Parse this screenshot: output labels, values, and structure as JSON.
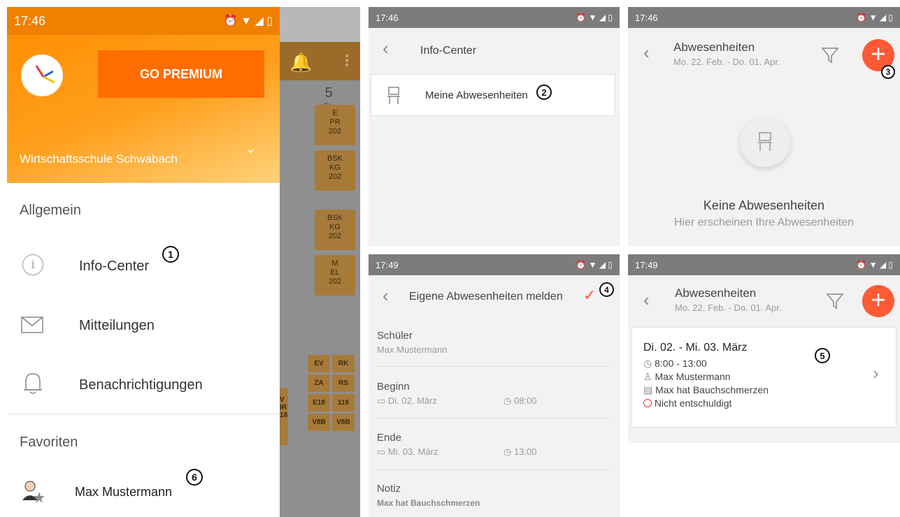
{
  "drawer": {
    "time": "17:46",
    "go_premium": "GO PREMIUM",
    "school": "Wirtschaftsschule Schwabach",
    "section_general": "Allgemein",
    "items": [
      {
        "label": "Info-Center",
        "icon": "info-icon"
      },
      {
        "label": "Mitteilungen",
        "icon": "mail-icon"
      },
      {
        "label": "Benachrichtigungen",
        "icon": "bell-icon"
      }
    ],
    "section_favorites": "Favoriten",
    "favorite_user": "Max Mustermann",
    "timetable_day_num": "5",
    "timetable_day_name": "Fr.",
    "timetable_cells": [
      {
        "text": "E\nPR\n202"
      },
      {
        "text": "BSK\nKG\n202"
      },
      {
        "text": "BSK\nKG\n202"
      },
      {
        "text": "M\nEL\n202"
      }
    ],
    "timetable_small": [
      [
        "EV",
        "RK"
      ],
      [
        "ZA",
        "RS"
      ],
      [
        "E18",
        "116"
      ],
      [
        "V8B",
        "V8B"
      ]
    ],
    "timetable_partial": [
      "V",
      "IR",
      "18"
    ],
    "badge1": "1",
    "badge6": "6"
  },
  "info_center": {
    "time": "17:46",
    "title": "Info-Center",
    "item": "Meine Abwesenheiten",
    "badge": "2"
  },
  "absences_empty": {
    "time": "17:46",
    "title": "Abwesenheiten",
    "range": "Mo. 22. Feb. - Do. 01. Apr.",
    "empty_title": "Keine Abwesenheiten",
    "empty_sub": "Hier erscheinen Ihre Abwesenheiten",
    "badge": "3"
  },
  "report_form": {
    "time": "17:49",
    "title": "Eigene Abwesenheiten melden",
    "badge": "4",
    "student_label": "Schüler",
    "student_value": "Max Mustermann",
    "begin_label": "Beginn",
    "begin_date": "Di. 02. März",
    "begin_time": "08:00",
    "end_label": "Ende",
    "end_date": "Mi. 03. März",
    "end_time": "13:00",
    "note_label": "Notiz",
    "note_value": "Max hat Bauchschmerzen"
  },
  "absences_list": {
    "time": "17:49",
    "title": "Abwesenheiten",
    "range": "Mo. 22. Feb. - Do. 01. Apr.",
    "badge": "5",
    "entry": {
      "dates": "Di. 02. - Mi. 03. März",
      "time": "8:00 - 13:00",
      "student": "Max Mustermann",
      "note": "Max hat Bauchschmerzen",
      "status": "Nicht entschuldigt"
    }
  },
  "colors": {
    "orange": "#ff8c00",
    "fab": "#ff5a36",
    "status_red": "#e53935"
  }
}
